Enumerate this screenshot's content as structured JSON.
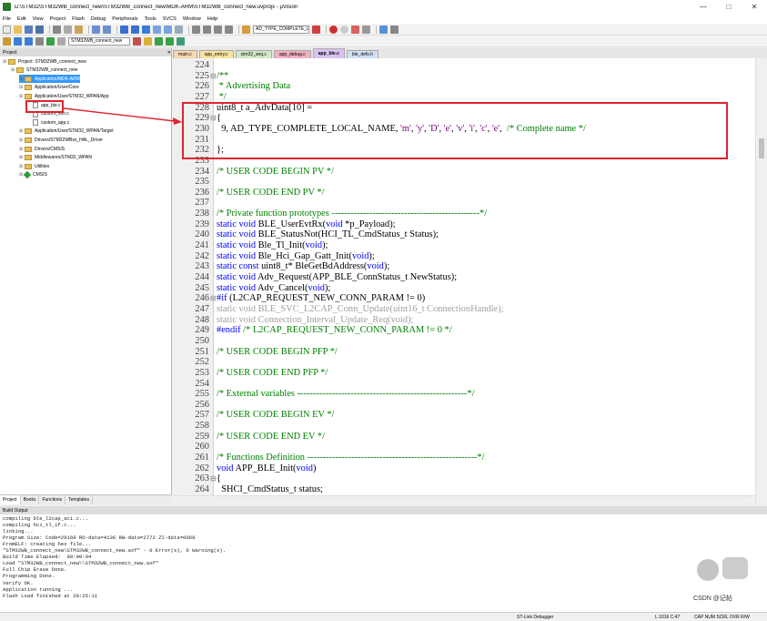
{
  "window": {
    "title": "D:\\STM32\\STM32WB_connect_new\\STM32WB_connect_new\\MDK-ARM\\STM32WB_connect_new.uvprojx - µVision"
  },
  "menu": [
    "File",
    "Edit",
    "View",
    "Project",
    "Flash",
    "Debug",
    "Peripherals",
    "Tools",
    "SVCS",
    "Window",
    "Help"
  ],
  "toolbar": {
    "search_combo": "AD_TYPE_COMPLETE_LOCA",
    "target_combo": "STM32WB_connect_new"
  },
  "project": {
    "header": "Project",
    "nodes": [
      {
        "label": "Project: STM32WB_connect_new",
        "level": 0
      },
      {
        "label": "STM32WB_connect_new",
        "level": 1
      },
      {
        "label": "Application/MDK-ARM",
        "level": 2,
        "selected": true
      },
      {
        "label": "Application/User/Core",
        "level": 2
      },
      {
        "label": "Application/User/STM32_WPAN/App",
        "level": 2
      },
      {
        "label": "app_ble.c",
        "level": 3
      },
      {
        "label": "custom_stm.c",
        "level": 3
      },
      {
        "label": "custom_app.c",
        "level": 3
      },
      {
        "label": "Application/User/STM32_WPAN/Target",
        "level": 2
      },
      {
        "label": "Drivers/STM32WBxx_HAL_Driver",
        "level": 2
      },
      {
        "label": "Drivers/CMSIS",
        "level": 2
      },
      {
        "label": "Middlewares/STM32_WPAN",
        "level": 2
      },
      {
        "label": "Utilities",
        "level": 2
      },
      {
        "label": "CMSIS",
        "level": 2
      }
    ],
    "tabs": [
      "Project",
      "Books",
      "Functions",
      "Templates"
    ]
  },
  "editor_tabs": [
    {
      "label": "main.c",
      "color": "#f7d7b0"
    },
    {
      "label": "app_entry.c",
      "color": "#f7e3a0"
    },
    {
      "label": "stm32_seq.c",
      "color": "#cfe8c7"
    },
    {
      "label": "app_debug.c",
      "color": "#f3b0c0"
    },
    {
      "label": "app_ble.c",
      "color": "#d9c3f0",
      "active": true
    },
    {
      "label": "ble_defs.h",
      "color": "#cfe0f5"
    }
  ],
  "code": [
    {
      "n": "224",
      "t": ""
    },
    {
      "n": "225",
      "t": "/**",
      "c": "cmt",
      "f": "⊟"
    },
    {
      "n": "226",
      "t": " * Advertising Data",
      "c": "cmt"
    },
    {
      "n": "227",
      "t": " */",
      "c": "cmt"
    },
    {
      "n": "228",
      "t": "uint8_t a_AdvData[10] ="
    },
    {
      "n": "229",
      "t": "{",
      "f": "⊟"
    },
    {
      "n": "230",
      "t": "  9, AD_TYPE_COMPLETE_LOCAL_NAME, 'm', 'y', 'D', 'e', 'v', 'i', 'c', 'e',  /* Complete name */"
    },
    {
      "n": "231",
      "t": ""
    },
    {
      "n": "232",
      "t": "};"
    },
    {
      "n": "233",
      "t": ""
    },
    {
      "n": "234",
      "t": "/* USER CODE BEGIN PV */",
      "c": "cmt"
    },
    {
      "n": "235",
      "t": ""
    },
    {
      "n": "236",
      "t": "/* USER CODE END PV */",
      "c": "cmt"
    },
    {
      "n": "237",
      "t": ""
    },
    {
      "n": "238",
      "t": "/* Private function prototypes -----------------------------------------------*/",
      "c": "cmt"
    },
    {
      "n": "239",
      "t": "static void BLE_UserEvtRx(void *p_Payload);"
    },
    {
      "n": "240",
      "t": "static void BLE_StatusNot(HCI_TL_CmdStatus_t Status);"
    },
    {
      "n": "241",
      "t": "static void Ble_Tl_Init(void);"
    },
    {
      "n": "242",
      "t": "static void Ble_Hci_Gap_Gatt_Init(void);"
    },
    {
      "n": "243",
      "t": "static const uint8_t* BleGetBdAddress(void);"
    },
    {
      "n": "244",
      "t": "static void Adv_Request(APP_BLE_ConnStatus_t NewStatus);"
    },
    {
      "n": "245",
      "t": "static void Adv_Cancel(void);"
    },
    {
      "n": "246",
      "t": "#if (L2CAP_REQUEST_NEW_CONN_PARAM != 0)",
      "c": "pp",
      "f": "⊟"
    },
    {
      "n": "247",
      "t": "static void BLE_SVC_L2CAP_Conn_Update(uint16_t ConnectionHandle);",
      "c": "dim"
    },
    {
      "n": "248",
      "t": "static void Connection_Interval_Update_Req(void);",
      "c": "dim"
    },
    {
      "n": "249",
      "t": "#endif /* L2CAP_REQUEST_NEW_CONN_PARAM != 0 */",
      "c": "pp"
    },
    {
      "n": "250",
      "t": ""
    },
    {
      "n": "251",
      "t": "/* USER CODE BEGIN PFP */",
      "c": "cmt"
    },
    {
      "n": "252",
      "t": ""
    },
    {
      "n": "253",
      "t": "/* USER CODE END PFP */",
      "c": "cmt"
    },
    {
      "n": "254",
      "t": ""
    },
    {
      "n": "255",
      "t": "/* External variables ------------------------------------------------------*/",
      "c": "cmt"
    },
    {
      "n": "256",
      "t": ""
    },
    {
      "n": "257",
      "t": "/* USER CODE BEGIN EV */",
      "c": "cmt"
    },
    {
      "n": "258",
      "t": ""
    },
    {
      "n": "259",
      "t": "/* USER CODE END EV */",
      "c": "cmt"
    },
    {
      "n": "260",
      "t": ""
    },
    {
      "n": "261",
      "t": "/* Functions Definition ------------------------------------------------------*/",
      "c": "cmt"
    },
    {
      "n": "262",
      "t": "void APP_BLE_Init(void)"
    },
    {
      "n": "263",
      "t": "{",
      "f": "⊟"
    },
    {
      "n": "264",
      "t": "  SHCI_CmdStatus_t status;"
    }
  ],
  "build": {
    "header": "Build Output",
    "lines": [
      "compiling ble_l2cap_aci.c...",
      "compiling hci_tl_if.c...",
      "linking...",
      "Program Size: Code=29160 RO-data=4136 RW-data=2772 ZI-data=6068",
      "FromELF: creating hex file...",
      "\"STM32WB_connect_new\\STM32WB_connect_new.axf\" - 0 Error(s), 0 Warning(s).",
      "Build Time Elapsed:  00:00:04",
      "Load \"STM32WB_connect_new\\\\STM32WB_connect_new.axf\"",
      "Full Chip Erase Done.",
      "Programming Done.",
      "Verify OK.",
      "Application running ...",
      "Flash Load finished at 20:25:11"
    ]
  },
  "status": {
    "debugger": "ST-Link Debugger",
    "position": "L:1016 C:47",
    "caps": "CAP NUM SCRL OVR R/W"
  },
  "watermark": {
    "text": "CSDN @记帖"
  },
  "colors": {
    "highlight": "#e0242e",
    "selection": "#3399ff",
    "comment": "#008000",
    "keyword": "#0000ff"
  }
}
